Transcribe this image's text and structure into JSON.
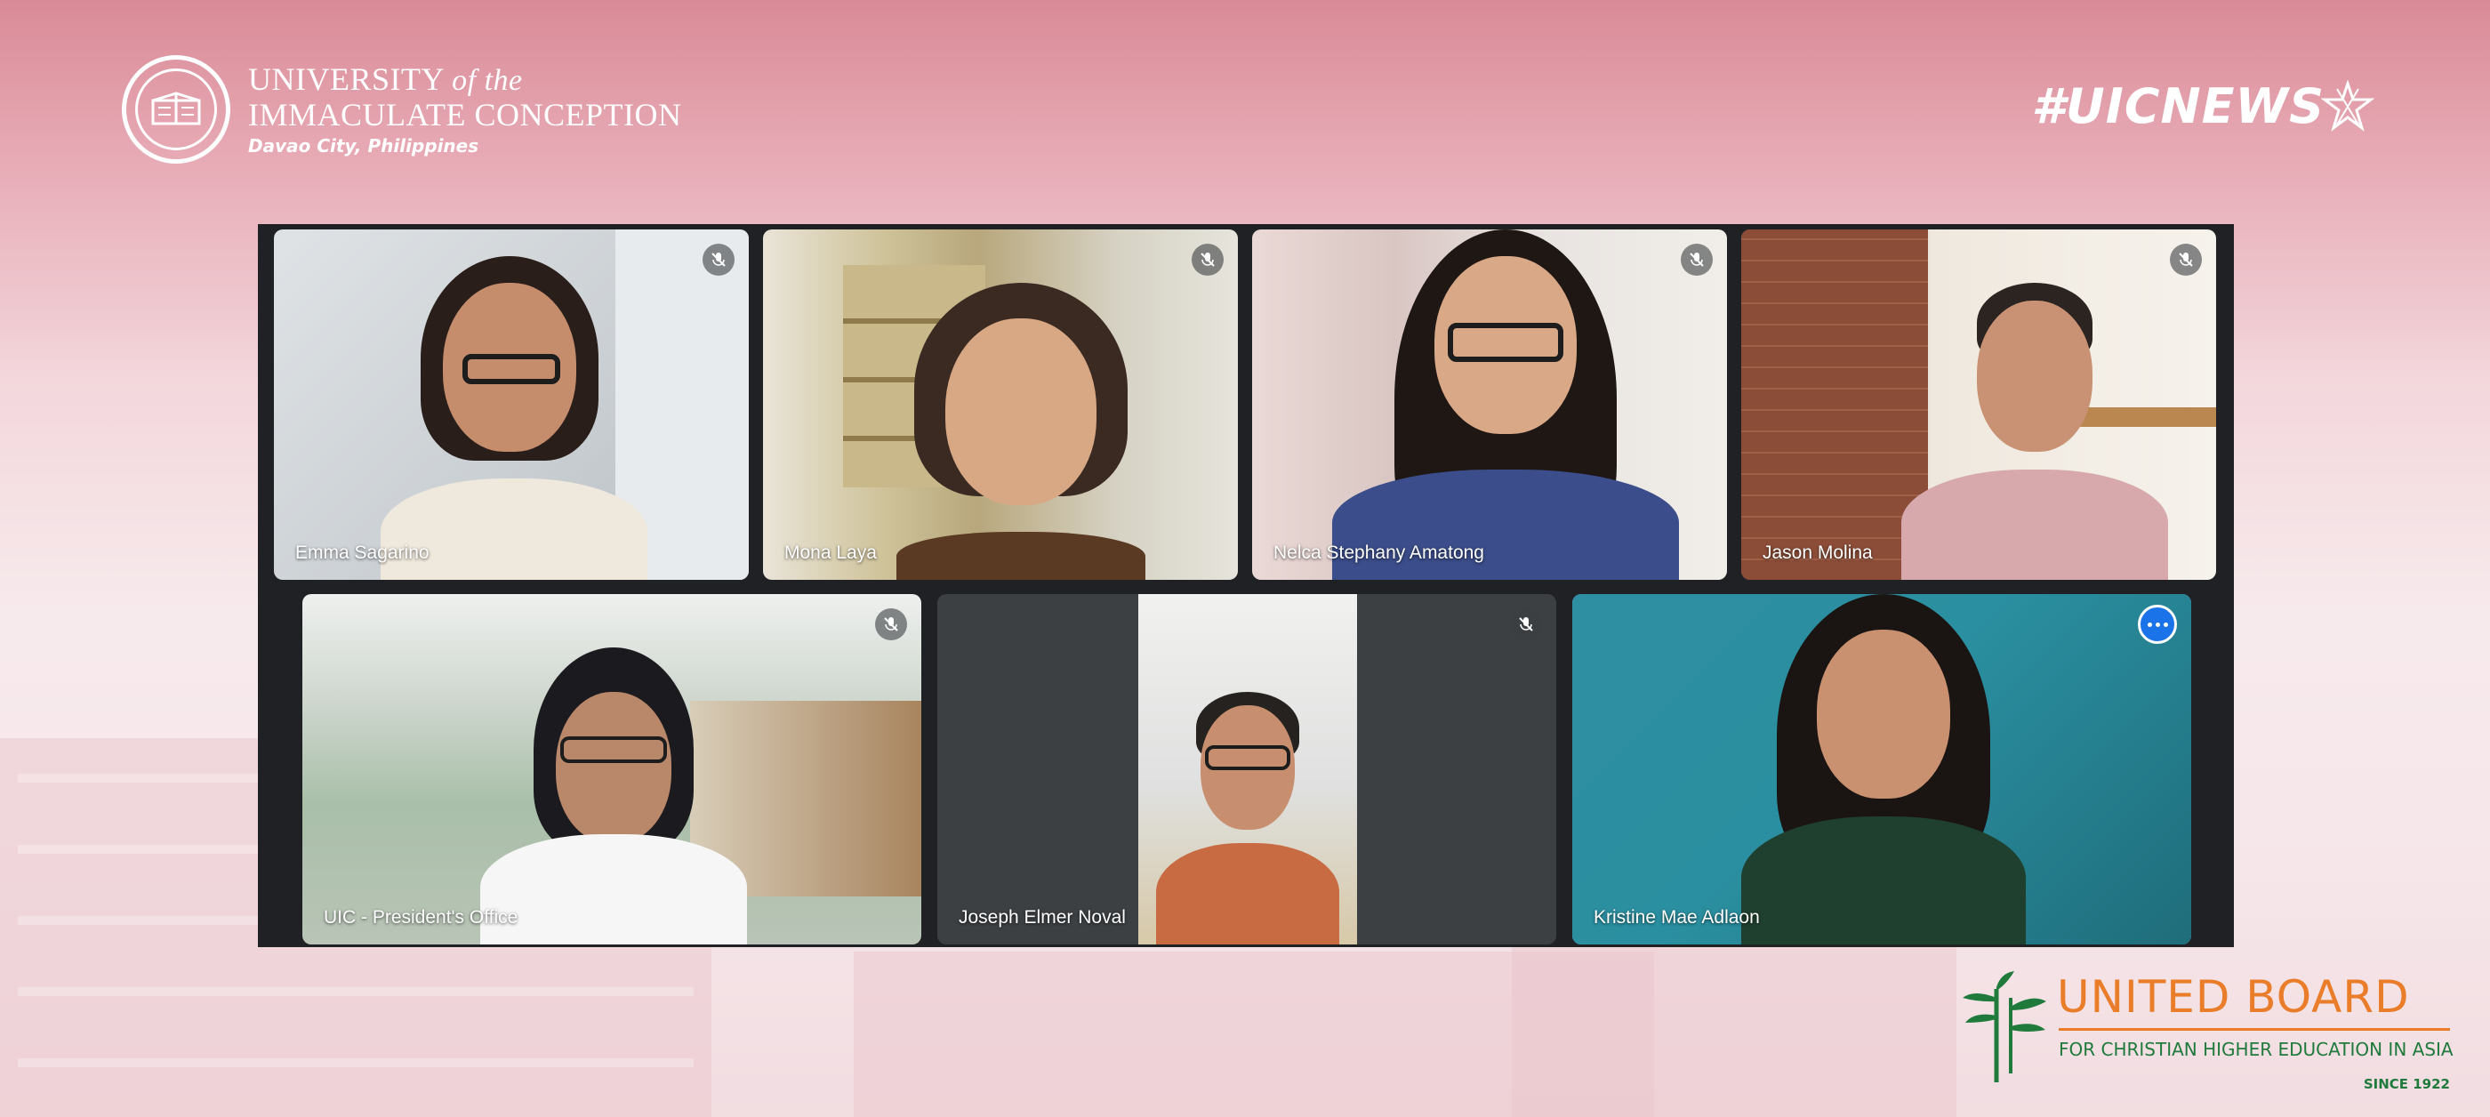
{
  "header": {
    "institution_line1": "UNIVERSITY",
    "institution_of_the": "of the",
    "institution_line2": "IMMACULATE CONCEPTION",
    "institution_location": "Davao City, Philippines",
    "hashtag": "#UICNEWS"
  },
  "meeting": {
    "participants": [
      {
        "name": "Emma Sagarino",
        "muted": true
      },
      {
        "name": "Mona Laya",
        "muted": true
      },
      {
        "name": "Nelca Stephany Amatong",
        "muted": true
      },
      {
        "name": "Jason Molina",
        "muted": true
      },
      {
        "name": "UIC - President's Office",
        "muted": true
      },
      {
        "name": "Joseph Elmer Noval",
        "muted": true
      },
      {
        "name": "Kristine Mae Adlaon",
        "muted": false,
        "active_speaker": true
      }
    ],
    "icons": {
      "mute": "mic-off-icon",
      "more": "more-options-icon"
    }
  },
  "footer": {
    "org_title": "UNITED BOARD",
    "org_subtitle": "FOR CHRISTIAN HIGHER EDUCATION IN ASIA",
    "org_since": "SINCE 1922"
  },
  "colors": {
    "brand_pink": "#d98b97",
    "meet_bg": "#202124",
    "speaker_outline": "#8ab4f8",
    "ub_orange": "#ea7d2a",
    "ub_green": "#1f7a3c"
  }
}
